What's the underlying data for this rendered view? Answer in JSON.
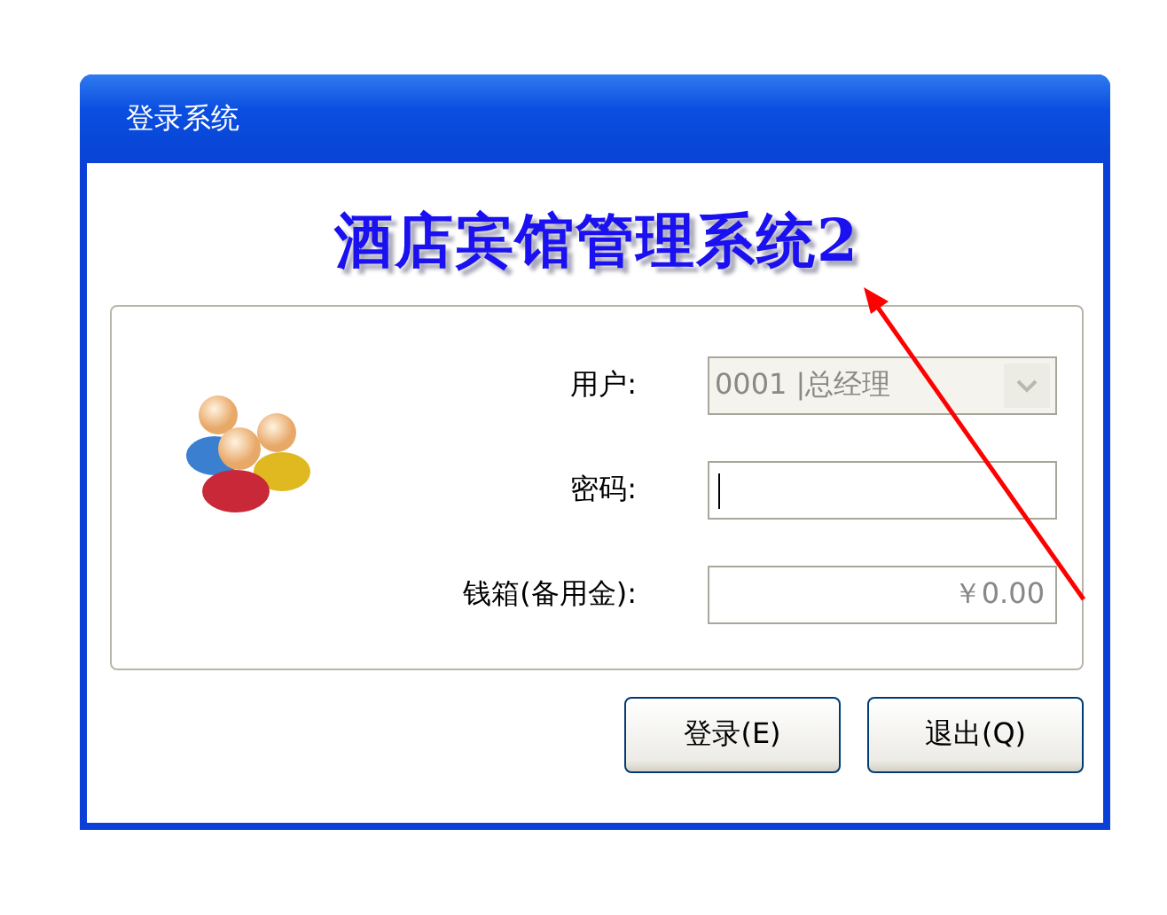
{
  "window": {
    "title": "登录系统"
  },
  "heading": "酒店宾馆管理系统2",
  "form": {
    "user": {
      "label": "用户:",
      "value": "0001 |总经理",
      "disabled": true
    },
    "password": {
      "label": "密码:",
      "focused": true
    },
    "cash": {
      "label": "钱箱(备用金):",
      "value": "￥0.00"
    }
  },
  "buttons": [
    {
      "label": "登录(E)"
    },
    {
      "label": "退出(Q)"
    }
  ],
  "annotation": {
    "kind": "arrow"
  }
}
